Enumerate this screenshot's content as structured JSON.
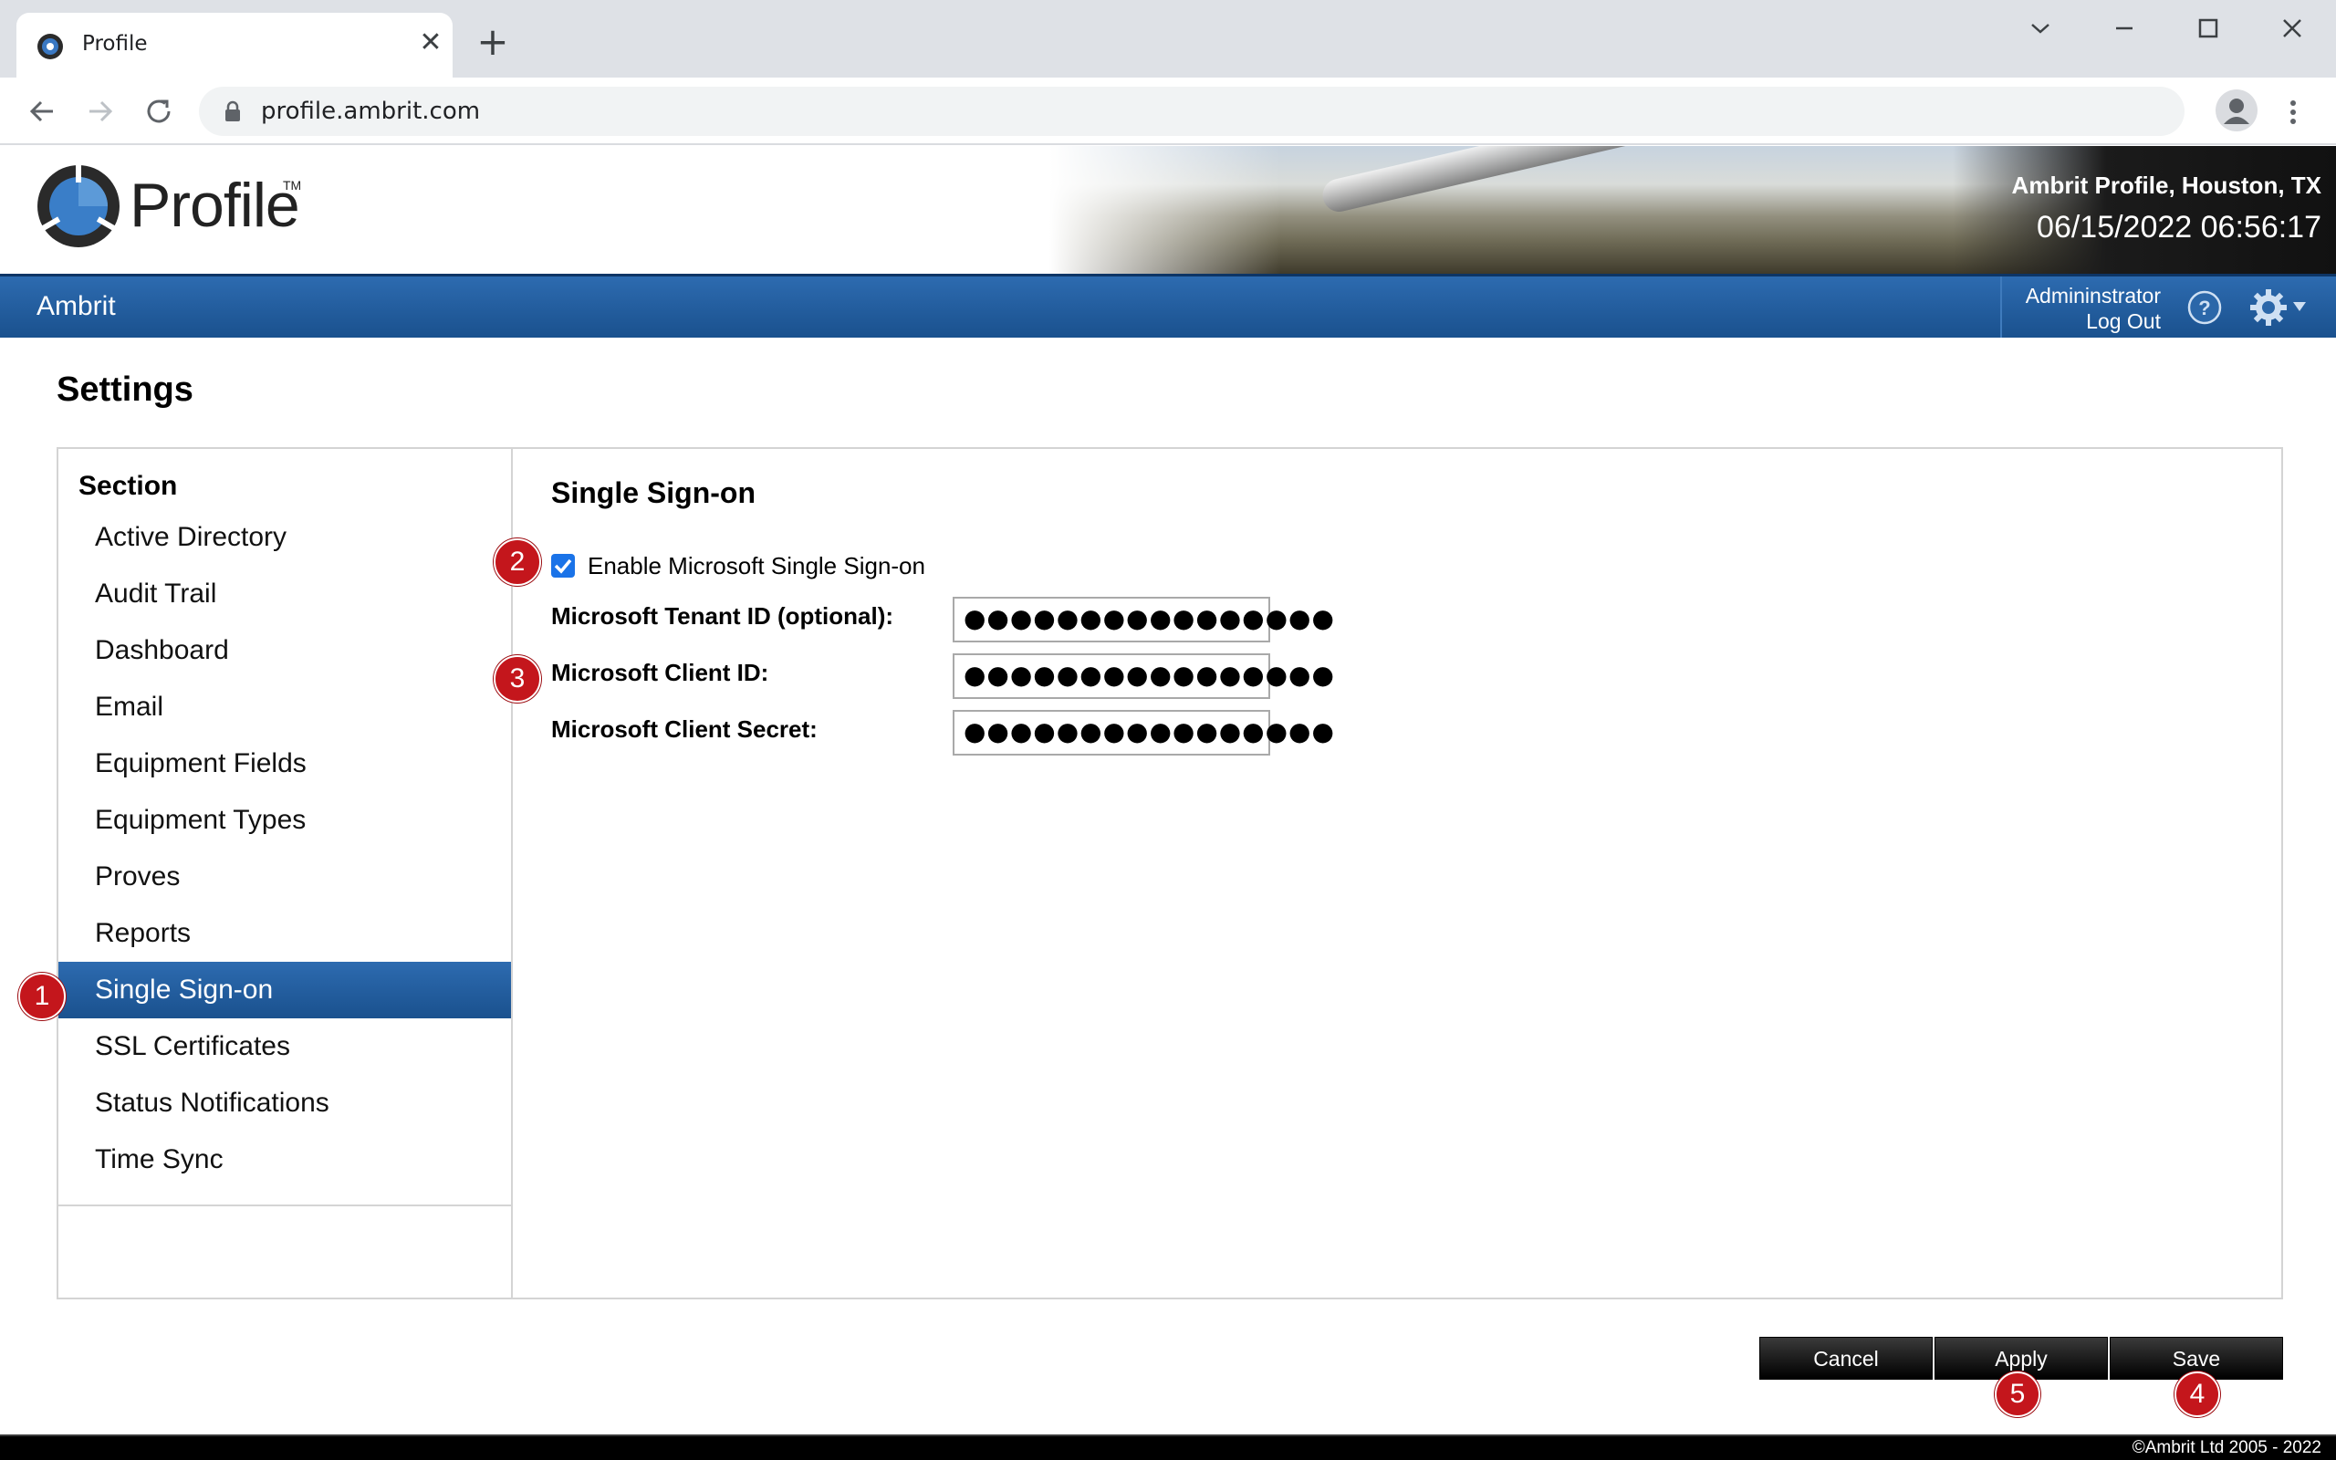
{
  "browser": {
    "tab_title": "Profile",
    "tab_close": "✕",
    "new_tab": "+",
    "url": "profile.ambrit.com"
  },
  "header": {
    "logo_text": "Profile",
    "logo_tm": "TM",
    "site_name": "Ambrit Profile, Houston, TX",
    "datetime": "06/15/2022 06:56:17"
  },
  "navbar": {
    "title": "Ambrit",
    "user": "Admininstrator",
    "logout": "Log Out"
  },
  "page": {
    "title": "Settings"
  },
  "sidebar": {
    "heading": "Section",
    "selected": "Single Sign-on",
    "items": [
      {
        "label": "Active Directory"
      },
      {
        "label": "Audit Trail"
      },
      {
        "label": "Dashboard"
      },
      {
        "label": "Email"
      },
      {
        "label": "Equipment Fields"
      },
      {
        "label": "Equipment Types"
      },
      {
        "label": "Proves"
      },
      {
        "label": "Reports"
      },
      {
        "label": "Single Sign-on"
      },
      {
        "label": "SSL Certificates"
      },
      {
        "label": "Status Notifications"
      },
      {
        "label": "Time Sync"
      }
    ]
  },
  "sso": {
    "heading": "Single Sign-on",
    "enable_label": "Enable Microsoft Single Sign-on",
    "enable_checked": true,
    "fields": [
      {
        "label": "Microsoft Tenant ID (optional):",
        "value": "●●●●●●●●●●●●●●●●"
      },
      {
        "label": "Microsoft Client ID:",
        "value": "●●●●●●●●●●●●●●●●"
      },
      {
        "label": "Microsoft Client Secret:",
        "value": "●●●●●●●●●●●●●●●●"
      }
    ]
  },
  "buttons": {
    "cancel": "Cancel",
    "apply": "Apply",
    "save": "Save"
  },
  "markers": [
    "1",
    "2",
    "3",
    "4",
    "5"
  ],
  "footer": {
    "copyright": "©Ambrit Ltd 2005 - 2022"
  },
  "colors": {
    "nav_blue": "#1a518e",
    "marker_red": "#c4161c",
    "checkbox_blue": "#1a73e8"
  }
}
